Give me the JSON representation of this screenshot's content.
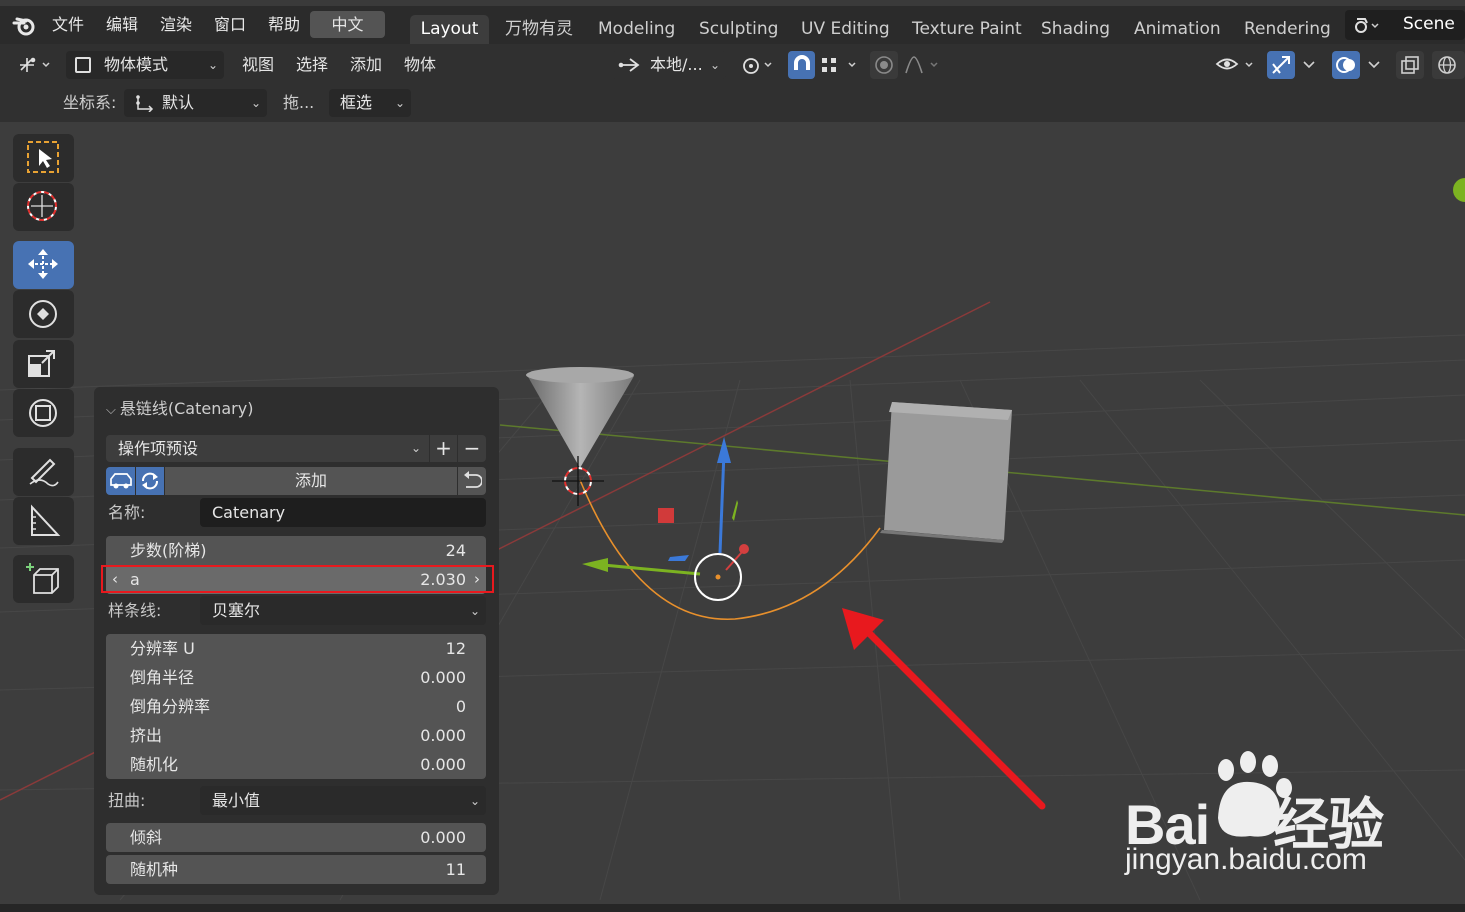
{
  "menu": {
    "items": [
      "文件",
      "编辑",
      "渲染",
      "窗口",
      "帮助"
    ],
    "language": "中文"
  },
  "workspaces": [
    "Layout",
    "万物有灵",
    "Modeling",
    "Sculpting",
    "UV Editing",
    "Texture Paint",
    "Shading",
    "Animation",
    "Rendering"
  ],
  "scene_label": "Scene",
  "header": {
    "mode": "物体模式",
    "view": "视图",
    "select": "选择",
    "add": "添加",
    "object": "物体",
    "transform_orientation": "本地/...",
    "coord_label": "坐标系:",
    "coord_value": "默认",
    "drag_label": "拖...",
    "select_mode": "框选"
  },
  "panel": {
    "title": "悬链线(Catenary)",
    "preset": "操作项预设",
    "add_button": "添加",
    "name_label": "名称:",
    "name_value": "Catenary",
    "steps_label": "步数(阶梯)",
    "steps_value": "24",
    "a_label": "a",
    "a_value": "2.030",
    "spline_label": "样条线:",
    "spline_value": "贝塞尔",
    "resolution_label": "分辨率 U",
    "resolution_value": "12",
    "bevel_radius_label": "倒角半径",
    "bevel_radius_value": "0.000",
    "bevel_res_label": "倒角分辨率",
    "bevel_res_value": "0",
    "extrude_label": "挤出",
    "extrude_value": "0.000",
    "random_label": "随机化",
    "random_value": "0.000",
    "twist_label": "扭曲:",
    "twist_value": "最小值",
    "tilt_label": "倾斜",
    "tilt_value": "0.000",
    "seed_label": "随机种",
    "seed_value": "11"
  },
  "watermark": {
    "brand": "Bai",
    "brand_suffix": "经验",
    "url": "jingyan.baidu.com"
  },
  "colors": {
    "accent": "#4772b3",
    "highlight_box": "#e8191e",
    "arrow": "#e8191e",
    "curve": "#e8902c"
  }
}
